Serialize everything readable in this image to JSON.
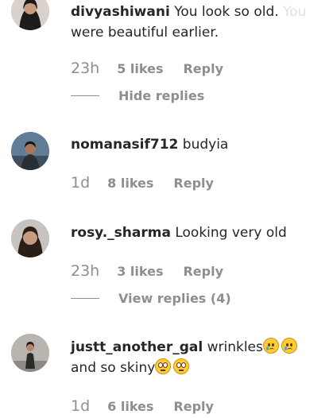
{
  "comments": [
    {
      "username": "divyashiwani",
      "text_main": "You look so old.",
      "text_faded": "You",
      "text_line2": "were beautiful earlier.",
      "time": "23h",
      "likes": "5 likes",
      "reply": "Reply",
      "replies_toggle": "Hide replies"
    },
    {
      "username": "nomanasif712",
      "text": "budyia",
      "time": "1d",
      "likes": "8 likes",
      "reply": "Reply"
    },
    {
      "username": "rosy._sharma",
      "text": "Looking very old",
      "time": "23h",
      "likes": "3 likes",
      "reply": "Reply",
      "replies_toggle": "View replies (4)"
    },
    {
      "username": "justt_another_gal",
      "text_line1": "wrinkles",
      "text_line2": "and so skiny",
      "emoji_line1": [
        "crying-face-icon",
        "crying-face-icon"
      ],
      "emoji_line2": [
        "eye-roll-face-icon",
        "eye-roll-face-icon"
      ],
      "time": "1d",
      "likes": "6 likes",
      "reply": "Reply"
    }
  ]
}
